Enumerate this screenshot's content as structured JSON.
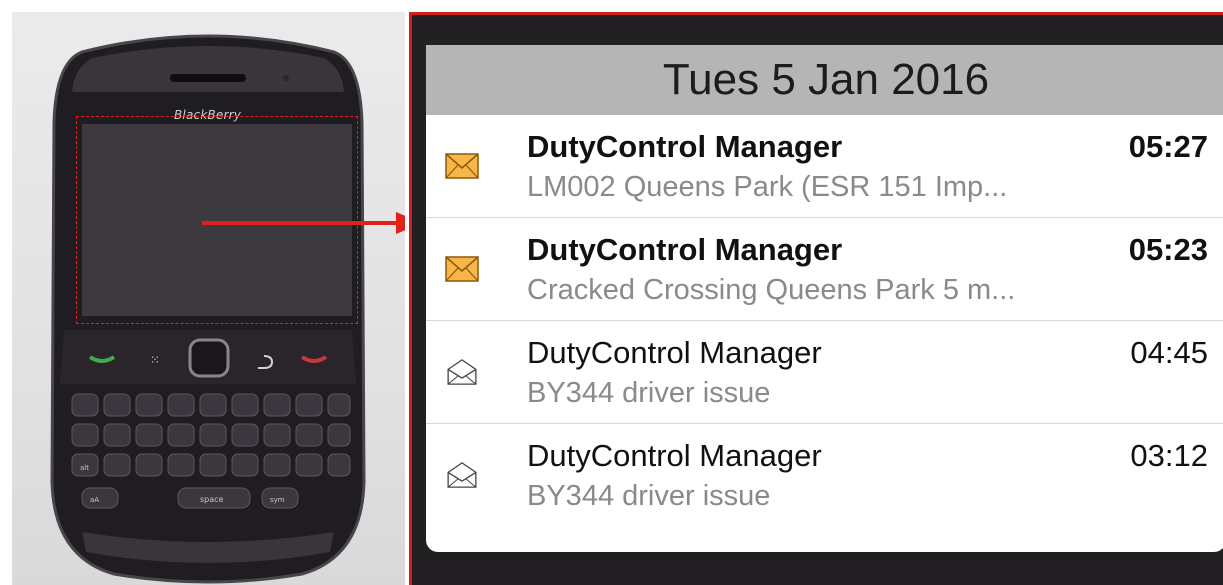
{
  "phone": {
    "brand": "BlackBerry",
    "keys": {
      "space": "space",
      "sym": "sym",
      "alt": "alt",
      "aA": "aA"
    }
  },
  "colors": {
    "highlight_red": "#d01f1f",
    "panel_bg": "#222022",
    "date_header_bg": "#b5b5b5",
    "unread_envelope": "#f9b548",
    "preview_text": "#8a8a8a"
  },
  "screen": {
    "date_header": "Tues 5 Jan 2016",
    "messages": [
      {
        "sender": "DutyControl Manager",
        "time": "05:27",
        "preview": "LM002 Queens Park (ESR 151 Imp...",
        "unread": true,
        "icon": "unread-envelope-icon"
      },
      {
        "sender": "DutyControl Manager",
        "time": "05:23",
        "preview": "Cracked Crossing Queens Park 5 m...",
        "unread": true,
        "icon": "unread-envelope-icon"
      },
      {
        "sender": "DutyControl Manager",
        "time": "04:45",
        "preview": "BY344 driver issue",
        "unread": false,
        "icon": "read-envelope-icon"
      },
      {
        "sender": "DutyControl Manager",
        "time": "03:12",
        "preview": "BY344 driver issue",
        "unread": false,
        "icon": "read-envelope-icon"
      }
    ]
  }
}
